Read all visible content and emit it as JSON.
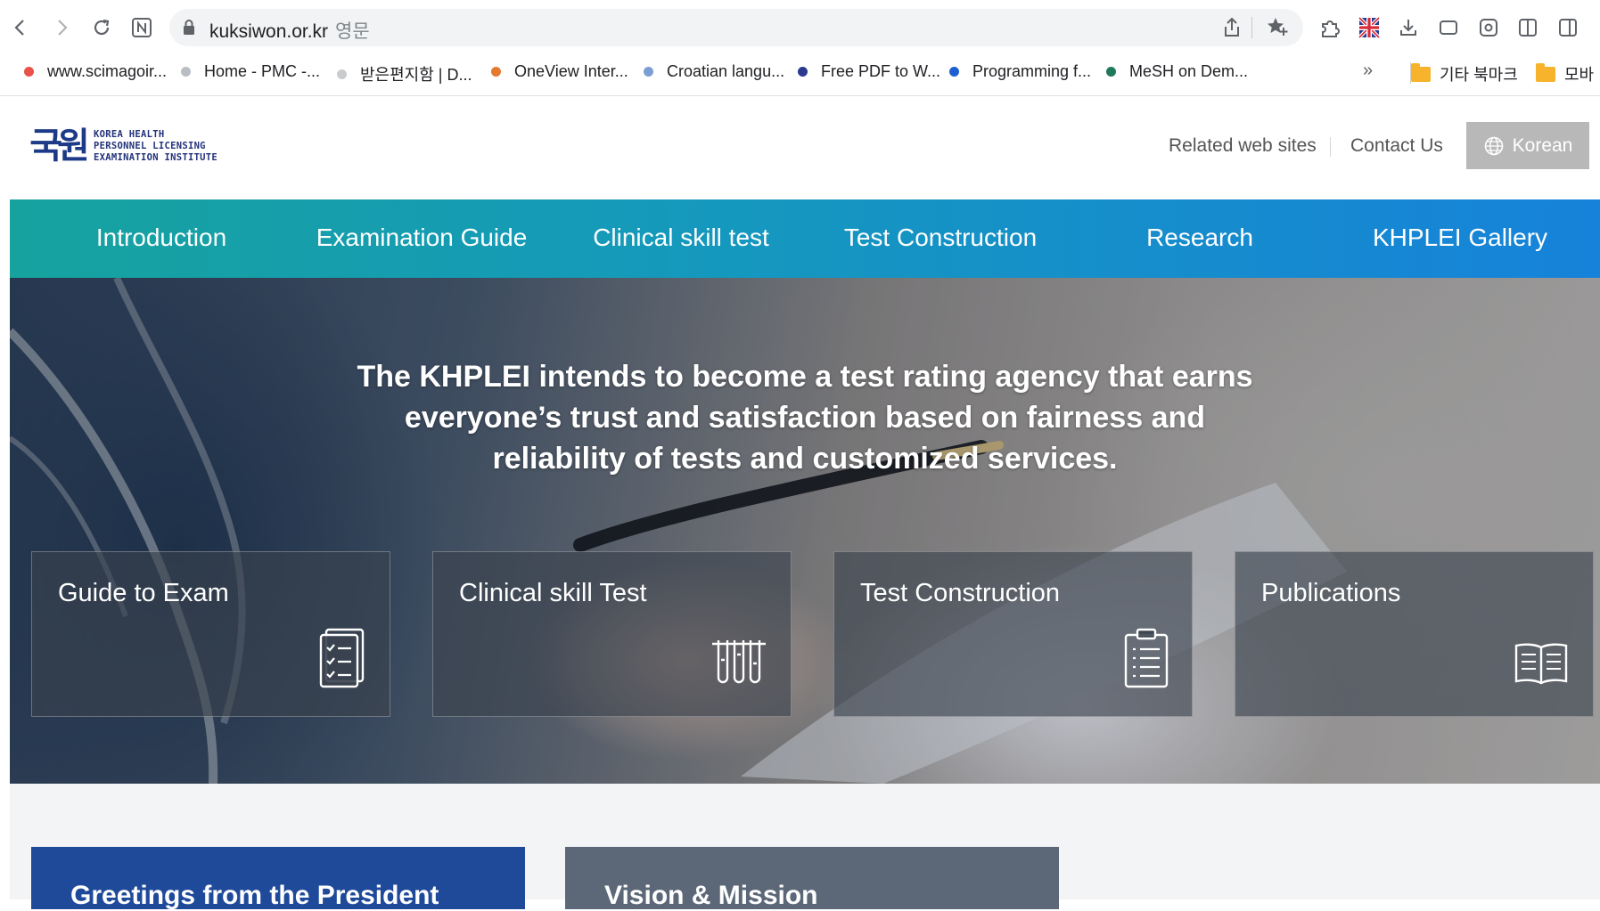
{
  "browser": {
    "url_host": "kuksiwon.or.kr",
    "url_suffix": "영문",
    "bookmarks": [
      {
        "label": "www.scimagoir...",
        "color": "#e8524a"
      },
      {
        "label": "Home - PMC -...",
        "color": "#b9bdc4"
      },
      {
        "label": "받은편지함 | D...",
        "color": "#c9cbcf"
      },
      {
        "label": "OneView Inter...",
        "color": "#e4792f"
      },
      {
        "label": "Croatian langu...",
        "color": "#7b9ed3"
      },
      {
        "label": "Free PDF to W...",
        "color": "#2b3a8f"
      },
      {
        "label": "Programming f...",
        "color": "#1d5fd1"
      },
      {
        "label": "MeSH on Dem...",
        "color": "#1f7a5a"
      }
    ],
    "more_label": "»",
    "folders": [
      {
        "label": "기타 북마크"
      },
      {
        "label": "모바"
      }
    ]
  },
  "header": {
    "logo_mark": "국원",
    "logo_lines": [
      "KOREA HEALTH",
      "PERSONNEL LICENSING",
      "EXAMINATION INSTITUTE"
    ],
    "related_sites": "Related web sites",
    "contact": "Contact Us",
    "language": "Korean"
  },
  "nav": [
    {
      "label": "Introduction"
    },
    {
      "label": "Examination Guide"
    },
    {
      "label": "Clinical skill test"
    },
    {
      "label": "Test Construction"
    },
    {
      "label": "Research"
    },
    {
      "label": "KHPLEI Gallery"
    }
  ],
  "hero": {
    "lines": [
      "The KHPLEI intends to become a test rating agency that earns",
      "everyone’s trust and satisfaction based on fairness and",
      "reliability of tests and customized services."
    ],
    "cards": [
      {
        "title": "Guide to Exam",
        "icon": "checklist-icon"
      },
      {
        "title": "Clinical skill Test",
        "icon": "test-tubes-icon"
      },
      {
        "title": "Test Construction",
        "icon": "clipboard-icon"
      },
      {
        "title": "Publications",
        "icon": "open-book-icon"
      }
    ]
  },
  "panels": [
    {
      "title": "Greetings from the President",
      "color": "#1f4a9a"
    },
    {
      "title": "Vision & Mission",
      "color": "#5c6878"
    }
  ],
  "colors": {
    "nav_start": "#16a39e",
    "nav_end": "#1682da",
    "brand_navy": "#1c3a87",
    "language_button": "#b8b8b8"
  }
}
